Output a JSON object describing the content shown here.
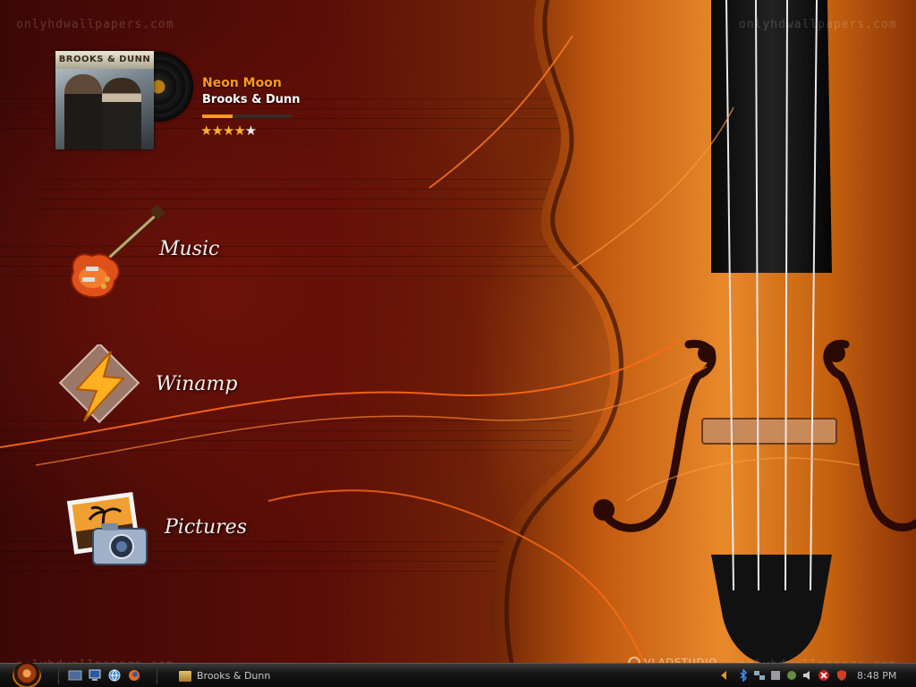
{
  "watermarks": {
    "site": "onlyhdwallpapers.com"
  },
  "now_playing": {
    "album_text": "BROOKS & DUNN",
    "title": "Neon Moon",
    "artist": "Brooks & Dunn",
    "progress_fraction": 0.34,
    "rating": 4,
    "rating_max": 5,
    "star_on": "★★★★",
    "star_off": "★"
  },
  "launchers": [
    {
      "label": "Music",
      "icon": "electric-guitar-icon"
    },
    {
      "label": "Winamp",
      "icon": "winamp-lightning-icon"
    },
    {
      "label": "Pictures",
      "icon": "photo-camera-icon"
    }
  ],
  "credit": "VLADSTUDIO",
  "taskbar": {
    "task_label": "Brooks & Dunn",
    "clock": "8:48 PM"
  },
  "colors": {
    "accent": "#ff9a1e",
    "taskbar": "#0a0a0a"
  }
}
